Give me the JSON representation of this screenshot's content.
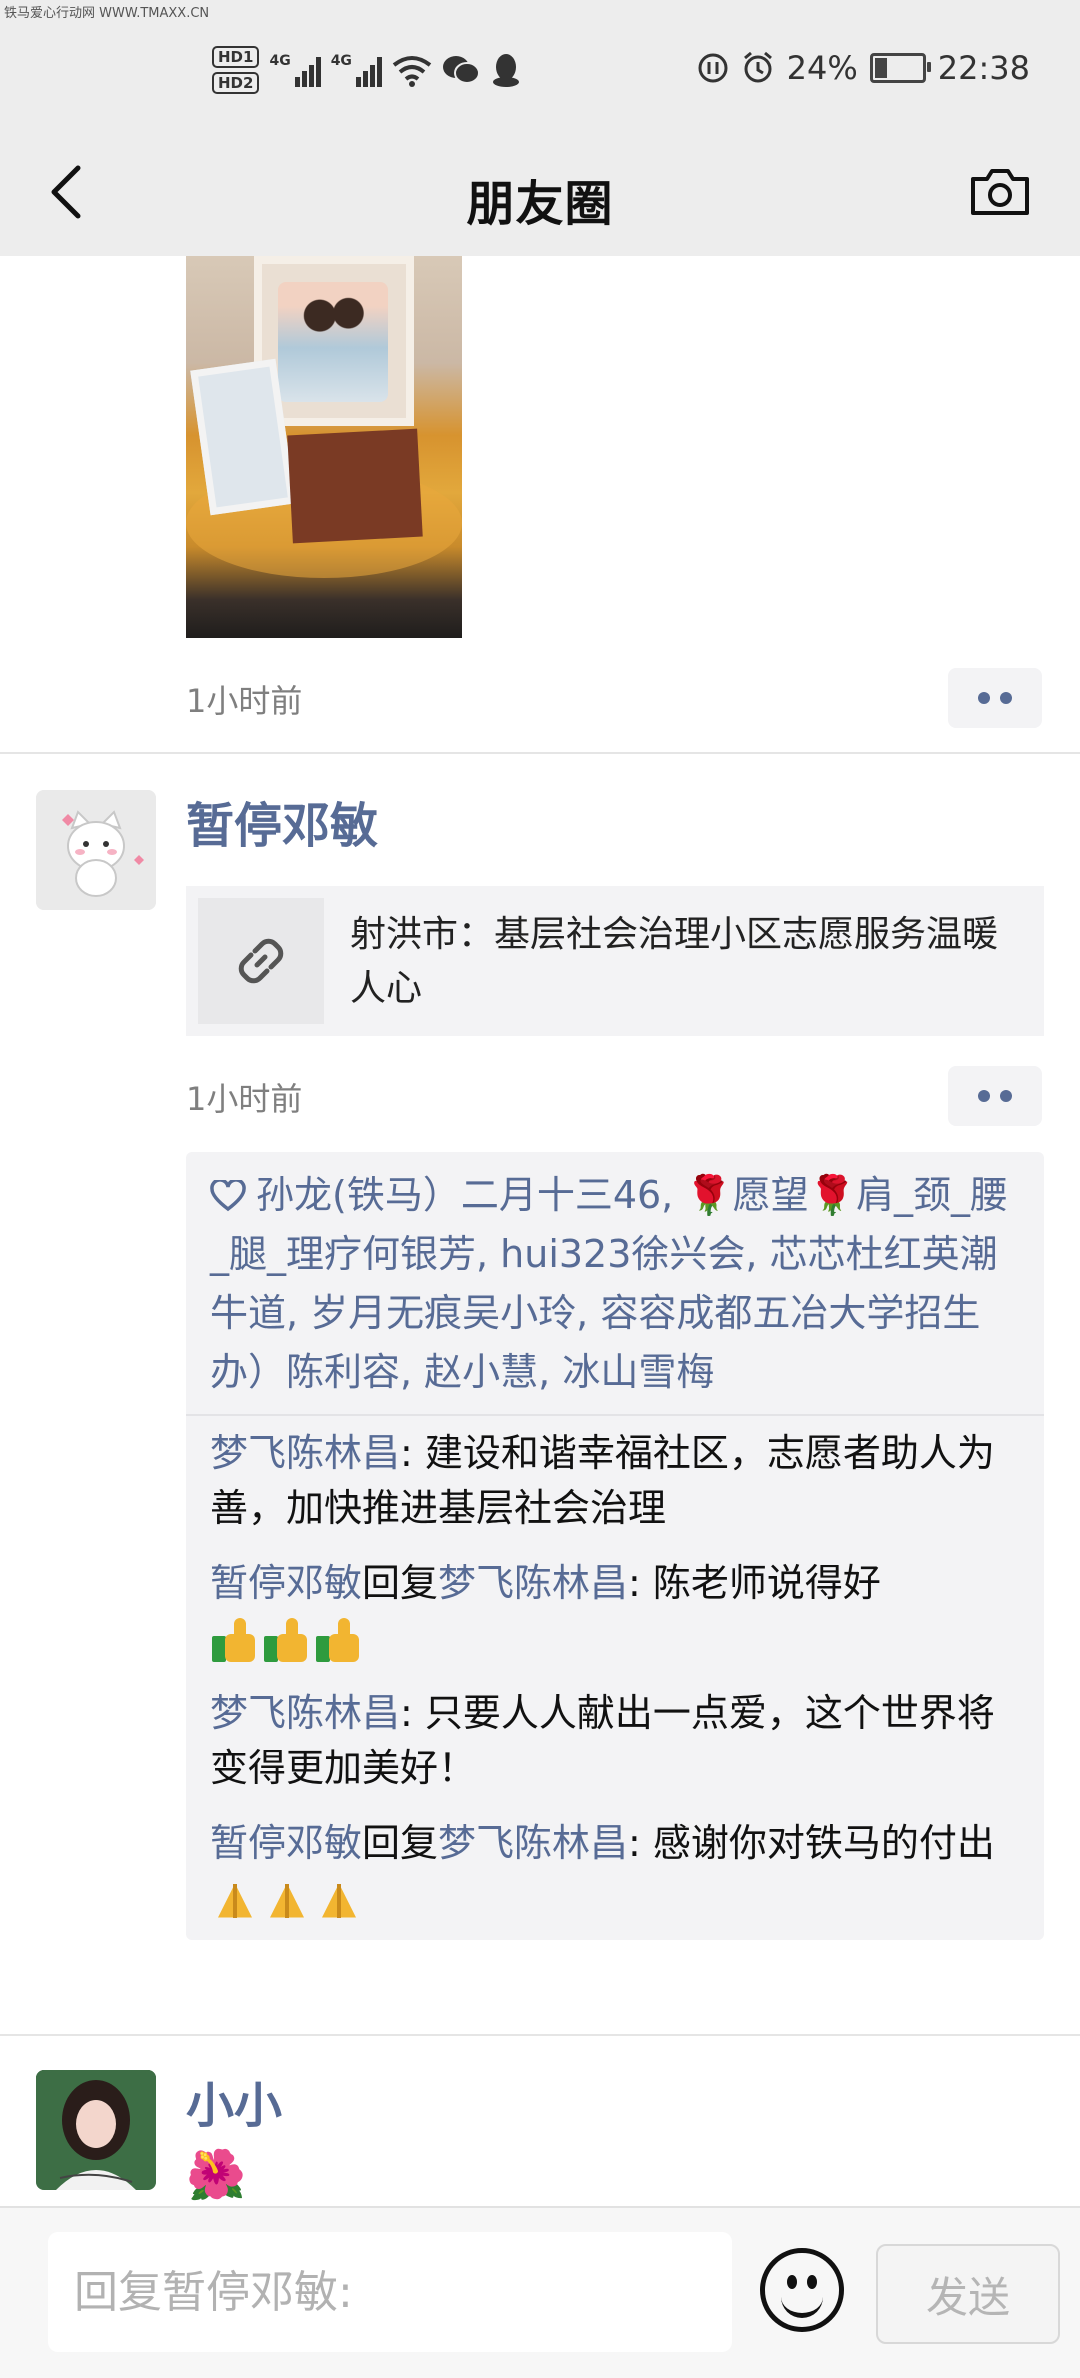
{
  "watermark": "铁马爱心行动网 WWW.TMAXX.CN",
  "status_bar": {
    "hd1": "HD1",
    "hd2": "HD2",
    "net1": "4G",
    "net2": "4G",
    "battery": "24%",
    "time": "22:38"
  },
  "header": {
    "title": "朋友圈"
  },
  "posts": [
    {
      "time": "1小时前"
    },
    {
      "nickname": "暂停邓敏",
      "link_title": "射洪市：基层社会治理小区志愿服务温暖人心",
      "time": "1小时前",
      "likes_text": "孙龙(铁马）二月十三46, 🌹愿望🌹肩_颈_腰_腿_理疗何银芳, hui323徐兴会, 芯芯杜红英潮牛道, 岁月无痕吴小玲, 容容成都五冶大学招生办）陈利容, 赵小慧, 冰山雪梅",
      "comments": [
        {
          "author": "梦飞陈林昌",
          "reply_word": "",
          "reply_to": "",
          "text": ": 建设和谐幸福社区，志愿者助人为善，加快推进基层社会治理"
        },
        {
          "author": "暂停邓敏",
          "reply_word": "回复",
          "reply_to": "梦飞陈林昌",
          "text": ": 陈老师说得好"
        },
        {
          "author": "梦飞陈林昌",
          "reply_word": "",
          "reply_to": "",
          "text": ": 只要人人献出一点爱，这个世界将变得更加美好！"
        },
        {
          "author": "暂停邓敏",
          "reply_word": "回复",
          "reply_to": "梦飞陈林昌",
          "text": ": 感谢你对铁马的付出"
        }
      ]
    },
    {
      "nickname": "小小",
      "text": "🌺"
    }
  ],
  "reply_bar": {
    "placeholder": "回复暂停邓敏:",
    "send_label": "发送"
  }
}
